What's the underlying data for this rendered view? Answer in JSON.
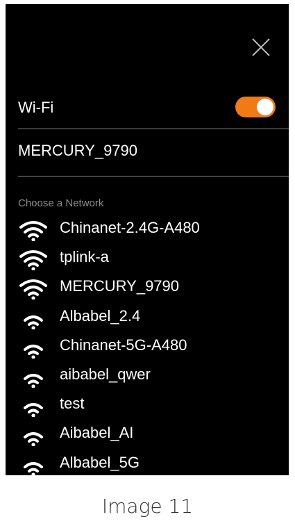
{
  "header": {
    "close_icon": "close-icon"
  },
  "wifi": {
    "label": "Wi-Fi",
    "enabled": true,
    "toggle_color": "#f07b14"
  },
  "connected": {
    "name": "MERCURY_9790"
  },
  "networks": {
    "section_label": "Choose a Network",
    "items": [
      {
        "name": "Chinanet-2.4G-A480",
        "signal": "strong"
      },
      {
        "name": "tplink-a",
        "signal": "strong"
      },
      {
        "name": "MERCURY_9790",
        "signal": "strong"
      },
      {
        "name": "Albabel_2.4",
        "signal": "weak"
      },
      {
        "name": "Chinanet-5G-A480",
        "signal": "weak"
      },
      {
        "name": "aibabel_qwer",
        "signal": "weak"
      },
      {
        "name": "test",
        "signal": "weak"
      },
      {
        "name": "Aibabel_AI",
        "signal": "weak"
      },
      {
        "name": "Albabel_5G",
        "signal": "weak"
      }
    ]
  },
  "caption": "Image 11"
}
